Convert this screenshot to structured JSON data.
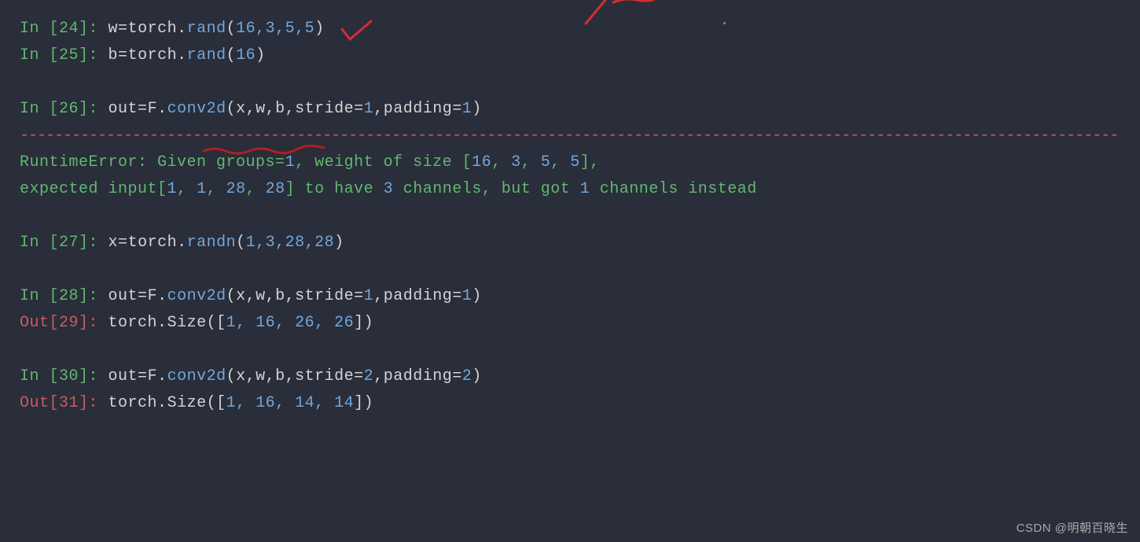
{
  "lines": {
    "l24_prompt": "In [24]: ",
    "l24_code": {
      "v1": "w",
      "op": "=",
      "obj": "torch",
      "dot": ".",
      "fn": "rand",
      "lp": "(",
      "args": "16,3,5,5",
      "rp": ")"
    },
    "l25_prompt": "In [25]: ",
    "l25_code": {
      "v1": "b",
      "op": "=",
      "obj": "torch",
      "dot": ".",
      "fn": "rand",
      "lp": "(",
      "args": "16",
      "rp": ")"
    },
    "l26_prompt": "In [26]: ",
    "l26_code": {
      "v1": "out",
      "op": "=",
      "obj": "F",
      "dot": ".",
      "fn": "conv2d",
      "lp": "(",
      "a1": "x,w,b,stride",
      "eq1": "=",
      "n1": "1",
      "c1": ",padding",
      "eq2": "=",
      "n2": "1",
      "rp": ")"
    },
    "sep": "------------------------------------------------------------------------------------------------------------------------------------------------",
    "err1_a": "RuntimeError",
    "err1_b": ": Given groups=",
    "err1_c": "1",
    "err1_d": ", weight of size [",
    "err1_e": "16",
    "err1_f": ", ",
    "err1_g": "3",
    "err1_h": ", ",
    "err1_i": "5",
    "err1_j": ", ",
    "err1_k": "5",
    "err1_l": "],",
    "err2_a": "expected input[",
    "err2_b": "1",
    "err2_c": ", ",
    "err2_d": "1",
    "err2_e": ", ",
    "err2_f": "28",
    "err2_g": ", ",
    "err2_h": "28",
    "err2_i": "] to have ",
    "err2_j": "3",
    "err2_k": " channels, but got ",
    "err2_l": "1",
    "err2_m": " channels instead",
    "l27_prompt": "In [27]: ",
    "l27_code": {
      "v1": "x",
      "op": "=",
      "obj": "torch",
      "dot": ".",
      "fn": "randn",
      "lp": "(",
      "args": "1,3,28,28",
      "rp": ")"
    },
    "l28_prompt": "In [28]: ",
    "l28_code": {
      "v1": "out",
      "op": "=",
      "obj": "F",
      "dot": ".",
      "fn": "conv2d",
      "lp": "(",
      "a1": "x,w,b,stride",
      "eq1": "=",
      "n1": "1",
      "c1": ",padding",
      "eq2": "=",
      "n2": "1",
      "rp": ")"
    },
    "l29_prompt": "Out[29]: ",
    "l29_out": {
      "obj": "torch",
      "dot": ".",
      "fn": "Size",
      "lp": "([",
      "args": "1, 16, 26, 26",
      "rp": "])"
    },
    "l30_prompt": "In [30]: ",
    "l30_code": {
      "v1": "out",
      "op": "=",
      "obj": "F",
      "dot": ".",
      "fn": "conv2d",
      "lp": "(",
      "a1": "x,w,b,stride",
      "eq1": "=",
      "n1": "2",
      "c1": ",padding",
      "eq2": "=",
      "n2": "2",
      "rp": ")"
    },
    "l31_prompt": "Out[31]: ",
    "l31_out": {
      "obj": "torch",
      "dot": ".",
      "fn": "Size",
      "lp": "([",
      "args": "1, 16, 14, 14",
      "rp": "])"
    }
  },
  "watermark": "CSDN @明朝百晓生"
}
